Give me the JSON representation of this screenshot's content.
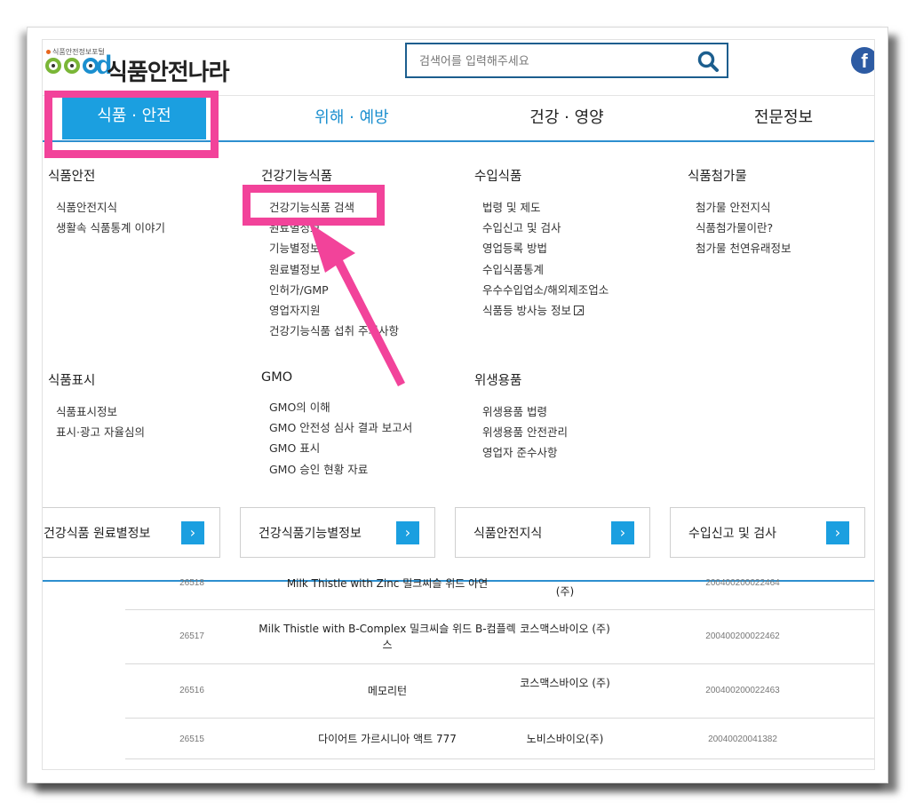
{
  "header": {
    "portal_label": "식품안전정보포털",
    "logo_letters": "d",
    "site_name": "식품안전나라",
    "search_placeholder": "검색어를 입력해주세요",
    "facebook_icon_letter": "f"
  },
  "nav": {
    "tabs": [
      "식품 · 안전",
      "위해 · 예방",
      "건강 · 영양",
      "전문정보"
    ],
    "active_index": 0
  },
  "menu": {
    "food_safety": {
      "title": "식품안전",
      "items": [
        "식품안전지식",
        "생활속 식품통계 이야기"
      ]
    },
    "health_func": {
      "title": "건강기능식품",
      "items": [
        "건강기능식품 검색",
        "원료별정보",
        "기능별정보",
        "원료별정보",
        "인허가/GMP",
        "영업자지원",
        "건강기능식품 섭취 주의사항"
      ]
    },
    "import_food": {
      "title": "수입식품",
      "items": [
        "법령 및 제도",
        "수입신고 및 검사",
        "영업등록 방법",
        "수입식품통계",
        "우수수입업소/해외제조업소",
        "식품등 방사능 정보"
      ]
    },
    "additives": {
      "title": "식품첨가물",
      "items": [
        "첨가물 안전지식",
        "식품첨가물이란?",
        "첨가물 천연유래정보"
      ]
    },
    "labeling": {
      "title": "식품표시",
      "items": [
        "식품표시정보",
        "표시·광고 자율심의"
      ]
    },
    "gmo": {
      "title": "GMO",
      "items": [
        "GMO의 이해",
        "GMO 안전성 심사 결과 보고서",
        "GMO 표시",
        "GMO 승인 현황 자료"
      ]
    },
    "hygiene": {
      "title": "위생용품",
      "items": [
        "위생용품 법령",
        "위생용품 안전관리",
        "영업자 준수사항"
      ]
    }
  },
  "quick_links": [
    "건강식품 원료별정보",
    "건강식품기능별정보",
    "식품안전지식",
    "수입신고 및 검사"
  ],
  "table_rows": [
    {
      "no": "26518",
      "name": "Milk Thistle with Zinc 밀크씨슬 위드 아연",
      "company": "(주)",
      "code": "200400200022464"
    },
    {
      "no": "26517",
      "name": "Milk Thistle with B-Complex 밀크씨슬 위드 B-컴플렉스",
      "company": "코스맥스바이오 (주)",
      "code": "200400200022462"
    },
    {
      "no": "26516",
      "name": "메모리턴",
      "company": "코스맥스바이오 (주)",
      "code": "200400200022463"
    },
    {
      "no": "26515",
      "name": "다이어트 가르시니아 액트 777",
      "company": "노비스바이오(주)",
      "code": "20040020041382"
    }
  ],
  "colors": {
    "accent": "#1b9fe0",
    "highlight": "#f2439a",
    "nav_line": "#2d8fcf"
  }
}
